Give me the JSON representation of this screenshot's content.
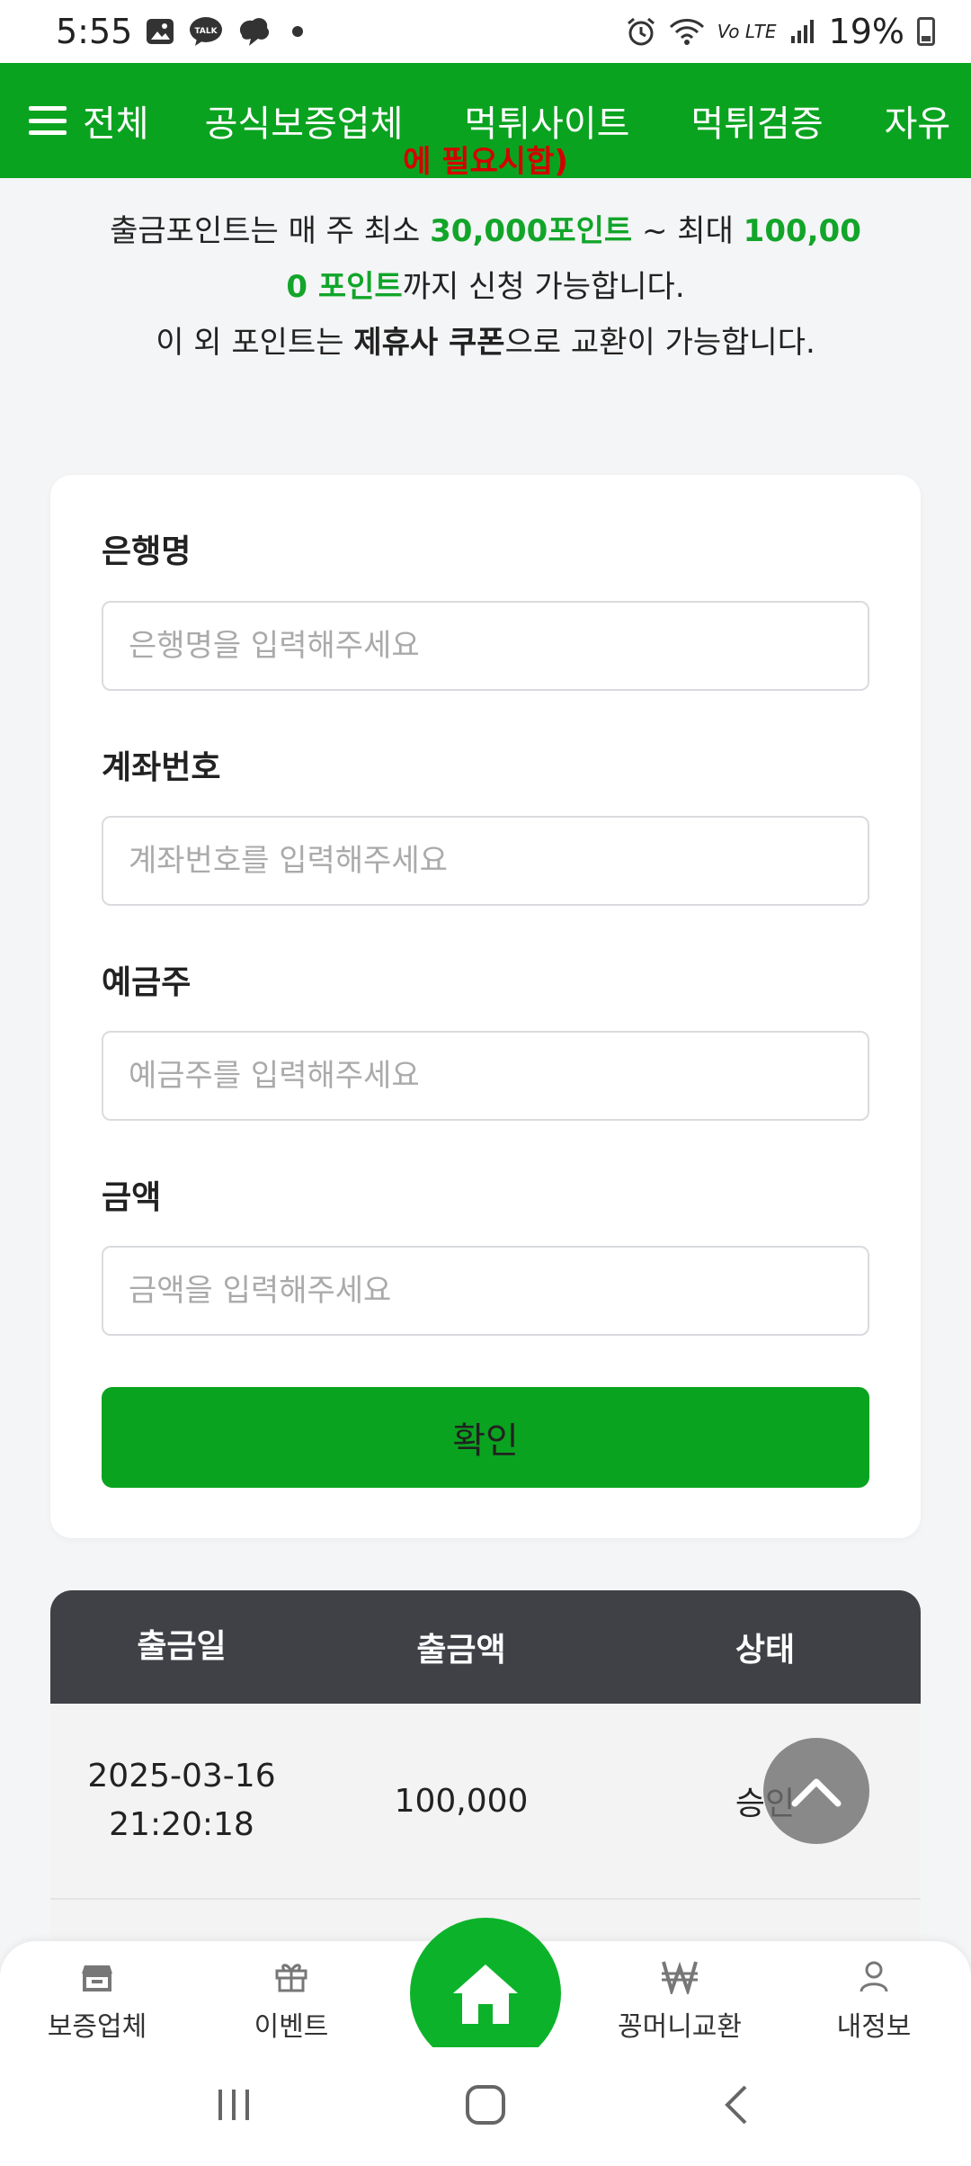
{
  "status_bar": {
    "time": "5:55",
    "battery": "19%",
    "network": "Vo LTE"
  },
  "top_nav": {
    "menu_label": "전체",
    "items": [
      "공식보증업체",
      "먹튀사이트",
      "먹튀검증",
      "자유"
    ]
  },
  "info": {
    "cut_line": "에 필요시합)",
    "line1_prefix": "출금포인트는 매 주 최소 ",
    "min_points": "30,000포인트",
    "line1_middle": " ~ 최대 ",
    "max_points_a": "100,00",
    "max_points_b": "0 포인트",
    "line2_suffix": "까지 신청 가능합니다.",
    "line3_prefix": "이 외 포인트는 ",
    "coupon": "제휴사 쿠폰",
    "line3_suffix": "으로 교환이 가능합니다."
  },
  "form": {
    "bank": {
      "label": "은행명",
      "placeholder": "은행명을 입력해주세요"
    },
    "account": {
      "label": "계좌번호",
      "placeholder": "계좌번호를 입력해주세요"
    },
    "holder": {
      "label": "예금주",
      "placeholder": "예금주를 입력해주세요"
    },
    "amount": {
      "label": "금액",
      "placeholder": "금액을 입력해주세요"
    },
    "submit_label": "확인"
  },
  "table": {
    "headers": [
      "출금일",
      "출금액",
      "상태"
    ],
    "rows": [
      {
        "date": "2025-03-16",
        "time": "21:20:18",
        "amount": "100,000",
        "status": "승인"
      }
    ]
  },
  "bottom_nav": {
    "items": [
      "보증업체",
      "이벤트",
      "꽁머니교환",
      "내정보"
    ]
  },
  "colors": {
    "brand_green": "#0aa31f",
    "header_dark": "#3f4147",
    "alert_red": "#d40000"
  }
}
